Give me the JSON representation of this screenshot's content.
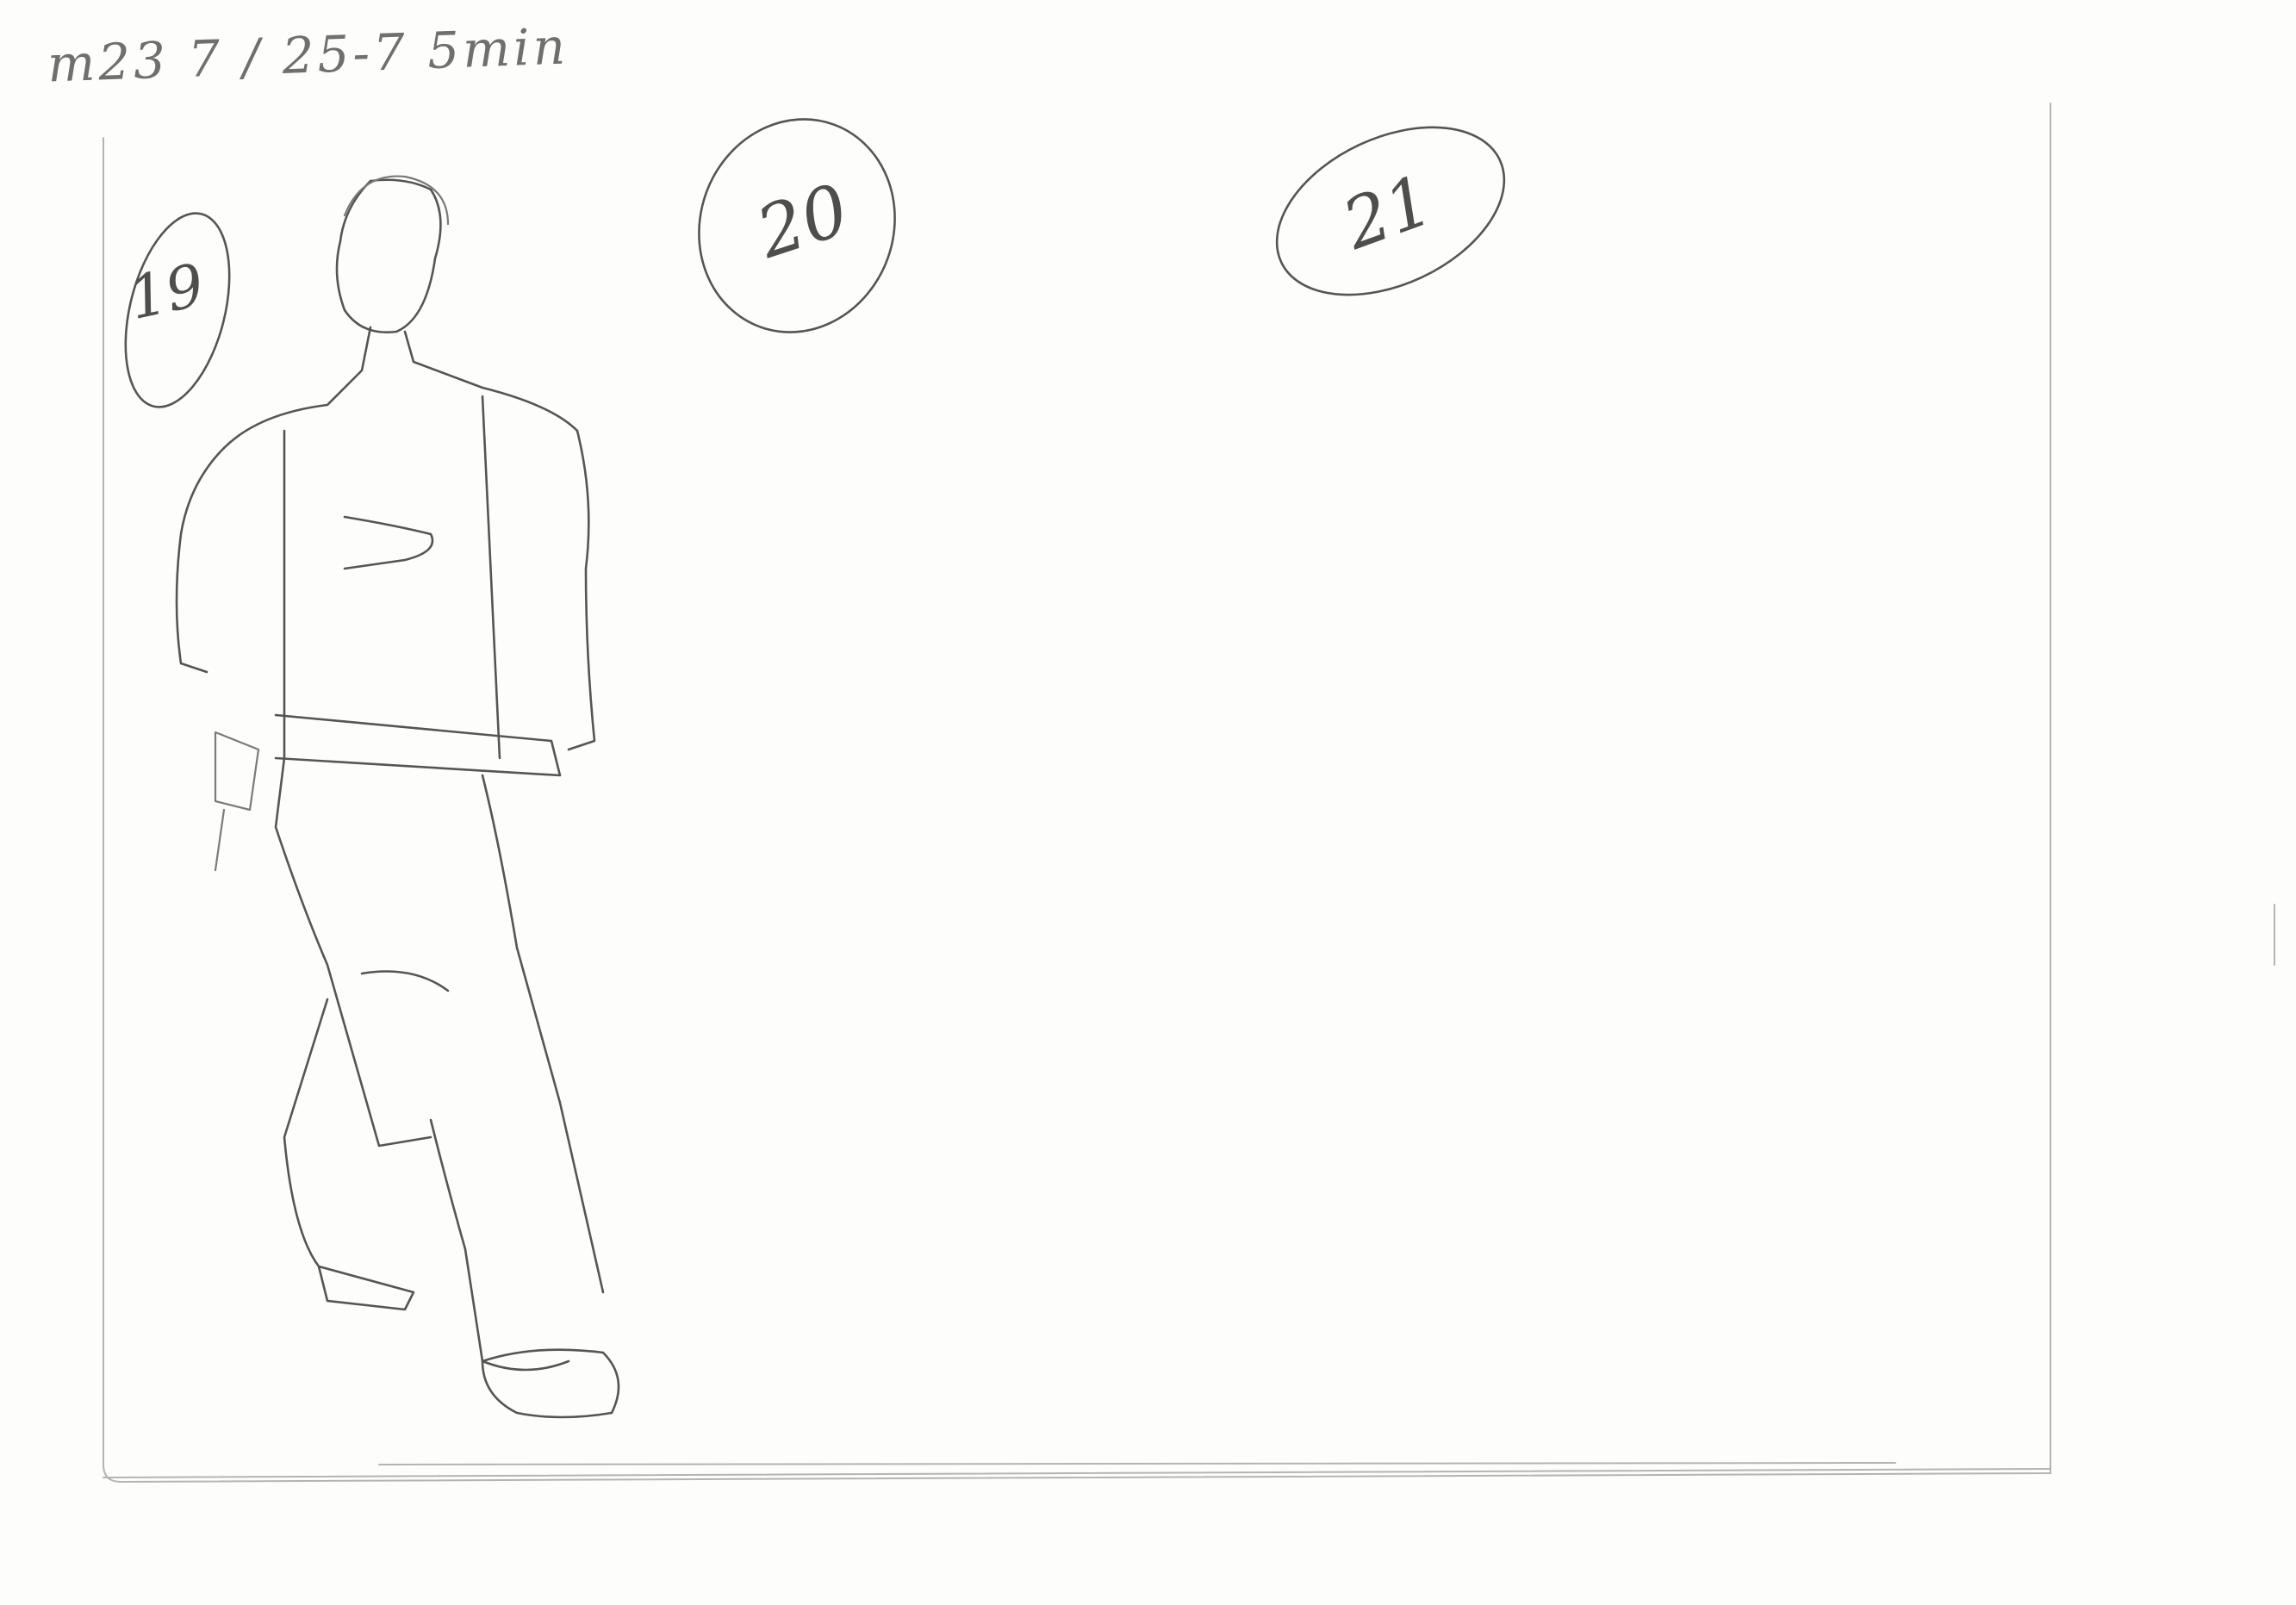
{
  "sheet": {
    "header_note": "m23 7 / 25-7 5min",
    "figures": [
      {
        "number": "19"
      },
      {
        "number": "20"
      },
      {
        "number": "21"
      },
      {
        "number": ""
      }
    ]
  },
  "colors": {
    "paper": "#fdfdfc",
    "pencil": "#555555",
    "ghost_lines": "#b4b4b4"
  }
}
